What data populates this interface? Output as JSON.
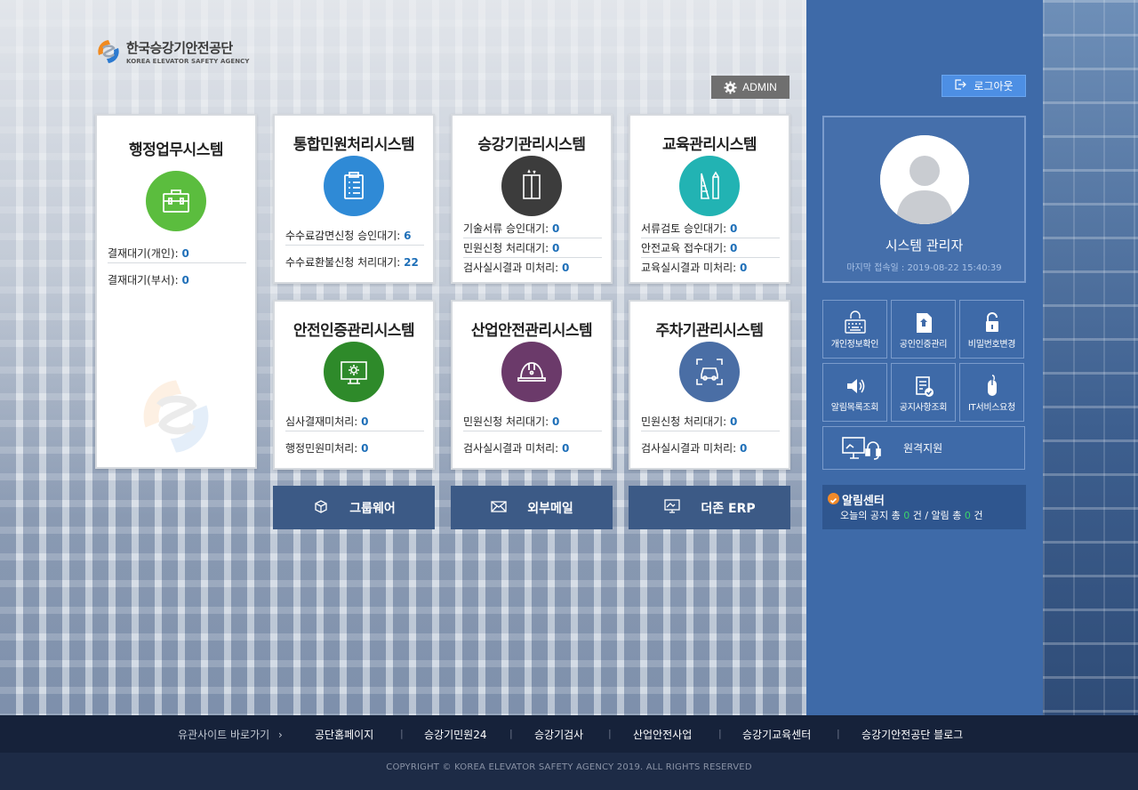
{
  "brand": {
    "name_ko": "한국승강기안전공단",
    "name_en": "KOREA ELEVATOR SAFETY AGENCY"
  },
  "header": {
    "admin_label": "ADMIN",
    "logout_label": "로그아웃"
  },
  "systems": [
    {
      "title": "행정업무시스템",
      "icon": "briefcase-icon",
      "color": "#5bbd3e",
      "stats": [
        {
          "label": "결재대기(개인):",
          "value": "0"
        },
        {
          "label": "결재대기(부서):",
          "value": "0"
        }
      ]
    },
    {
      "title": "통합민원처리시스템",
      "icon": "clipboard-icon",
      "color": "#2f8ad6",
      "stats": [
        {
          "label": "수수료감면신청 승인대기:",
          "value": "6"
        },
        {
          "label": "수수료환불신청 처리대기:",
          "value": "22"
        }
      ]
    },
    {
      "title": "승강기관리시스템",
      "icon": "elevator-icon",
      "color": "#3c3c3c",
      "stats": [
        {
          "label": "기술서류 승인대기:",
          "value": "0"
        },
        {
          "label": "민원신청 처리대기:",
          "value": "0"
        },
        {
          "label": "검사실시결과 미처리:",
          "value": "0"
        }
      ]
    },
    {
      "title": "교육관리시스템",
      "icon": "ruler-pencil-icon",
      "color": "#22b3b3",
      "stats": [
        {
          "label": "서류검토 승인대기:",
          "value": "0"
        },
        {
          "label": "안전교육 접수대기:",
          "value": "0"
        },
        {
          "label": "교육실시결과 미처리:",
          "value": "0"
        }
      ]
    },
    {
      "title": "안전인증관리시스템",
      "icon": "certification-monitor-icon",
      "color": "#2e8a2a",
      "stats": [
        {
          "label": "심사결재미처리:",
          "value": "0"
        },
        {
          "label": "행정민원미처리:",
          "value": "0"
        }
      ]
    },
    {
      "title": "산업안전관리시스템",
      "icon": "hardhat-icon",
      "color": "#6b3a6a",
      "stats": [
        {
          "label": "민원신청 처리대기:",
          "value": "0"
        },
        {
          "label": "검사실시결과 미처리:",
          "value": "0"
        }
      ]
    },
    {
      "title": "주차기관리시스템",
      "icon": "parking-car-icon",
      "color": "#4a6ea5",
      "stats": [
        {
          "label": "민원신청 처리대기:",
          "value": "0"
        },
        {
          "label": "검사실시결과 미처리:",
          "value": "0"
        }
      ]
    }
  ],
  "quick_links": [
    {
      "label": "그룹웨어",
      "icon": "cube-icon"
    },
    {
      "label": "외부메일",
      "icon": "envelope-icon"
    },
    {
      "label": "더존 ERP",
      "icon": "monitor-icon"
    }
  ],
  "profile": {
    "name": "시스템 관리자",
    "last_login": "마지막 접속일 : 2019-08-22 15:40:39"
  },
  "tiles": [
    {
      "label": "개인정보확인",
      "icon": "keyboard-lock-icon"
    },
    {
      "label": "공인인증관리",
      "icon": "certificate-icon"
    },
    {
      "label": "비밀번호변경",
      "icon": "padlock-icon"
    },
    {
      "label": "알림목록조회",
      "icon": "speaker-icon"
    },
    {
      "label": "공지사항조회",
      "icon": "notice-check-icon"
    },
    {
      "label": "IT서비스요청",
      "icon": "mouse-icon"
    }
  ],
  "remote": {
    "label": "원격지원",
    "icon": "remote-support-icon"
  },
  "notice": {
    "title": "알림센터",
    "text_prefix": "오늘의 공지 총",
    "notice_count": "0",
    "text_middle": "건 / 알림 총",
    "alert_count": "0",
    "text_suffix": "건"
  },
  "footer": {
    "lead": "유관사이트 바로가기",
    "links": [
      "공단홈페이지",
      "승강기민원24",
      "승강기검사",
      "산업안전사업",
      "승강기교육센터",
      "승강기안전공단 블로그"
    ],
    "copyright": "COPYRIGHT © KOREA ELEVATOR SAFETY AGENCY 2019. ALL RIGHTS RESERVED"
  },
  "colors": {
    "panel": "#3e6aa8",
    "quick_button": "#3c5a86",
    "value_blue": "#1e6fb8",
    "logout": "#4d8fe4",
    "footer": "#16223a",
    "notice_count": "#3bd36b"
  }
}
